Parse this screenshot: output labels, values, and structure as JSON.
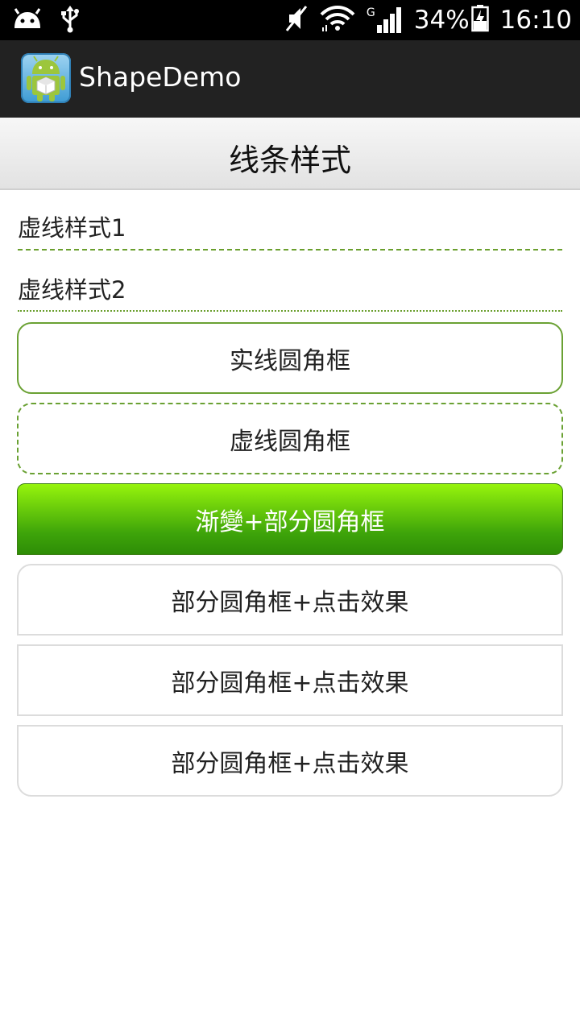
{
  "status_bar": {
    "battery": "34%",
    "time": "16:10",
    "network": "G",
    "icons": [
      "android-debug-icon",
      "usb-icon",
      "mute-icon",
      "wifi-icon",
      "signal-icon",
      "battery-charging-icon"
    ]
  },
  "action_bar": {
    "title": "ShapeDemo"
  },
  "page": {
    "title": "线条样式",
    "dashed_label_1": "虚线样式1",
    "dashed_label_2": "虚线样式2",
    "buttons": {
      "solid_rounded": "实线圆角框",
      "dashed_rounded": "虚线圆角框",
      "gradient_partial": "渐變+部分圆角框",
      "partial_click_1": "部分圆角框+点击效果",
      "partial_click_2": "部分圆角框+点击效果",
      "partial_click_3": "部分圆角框+点击效果"
    }
  },
  "colors": {
    "green_border": "#6aa133",
    "gradient_top": "#96f40c",
    "gradient_bottom": "#2e8d06",
    "action_bar_bg": "#222222"
  }
}
